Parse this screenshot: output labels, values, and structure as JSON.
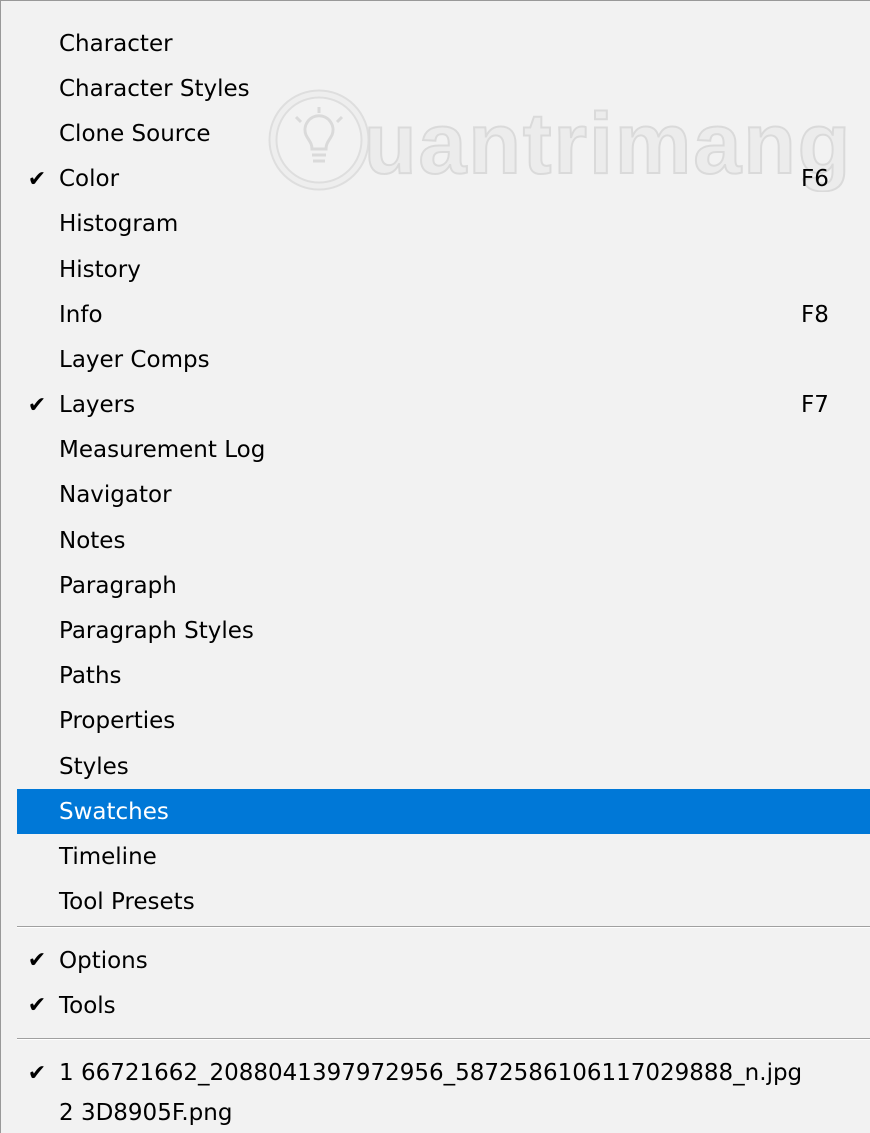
{
  "watermark": {
    "text": "uantrimang"
  },
  "panels": [
    {
      "label": "Character",
      "checked": false,
      "shortcut": ""
    },
    {
      "label": "Character Styles",
      "checked": false,
      "shortcut": ""
    },
    {
      "label": "Clone Source",
      "checked": false,
      "shortcut": ""
    },
    {
      "label": "Color",
      "checked": true,
      "shortcut": "F6"
    },
    {
      "label": "Histogram",
      "checked": false,
      "shortcut": ""
    },
    {
      "label": "History",
      "checked": false,
      "shortcut": ""
    },
    {
      "label": "Info",
      "checked": false,
      "shortcut": "F8"
    },
    {
      "label": "Layer Comps",
      "checked": false,
      "shortcut": ""
    },
    {
      "label": "Layers",
      "checked": true,
      "shortcut": "F7"
    },
    {
      "label": "Measurement Log",
      "checked": false,
      "shortcut": ""
    },
    {
      "label": "Navigator",
      "checked": false,
      "shortcut": ""
    },
    {
      "label": "Notes",
      "checked": false,
      "shortcut": ""
    },
    {
      "label": "Paragraph",
      "checked": false,
      "shortcut": ""
    },
    {
      "label": "Paragraph Styles",
      "checked": false,
      "shortcut": ""
    },
    {
      "label": "Paths",
      "checked": false,
      "shortcut": ""
    },
    {
      "label": "Properties",
      "checked": false,
      "shortcut": ""
    },
    {
      "label": "Styles",
      "checked": false,
      "shortcut": ""
    },
    {
      "label": "Swatches",
      "checked": false,
      "shortcut": "",
      "selected": true
    },
    {
      "label": "Timeline",
      "checked": false,
      "shortcut": ""
    },
    {
      "label": "Tool Presets",
      "checked": false,
      "shortcut": ""
    }
  ],
  "workspace": [
    {
      "label": "Options",
      "checked": true
    },
    {
      "label": "Tools",
      "checked": true
    }
  ],
  "documents": [
    {
      "label": "1 66721662_2088041397972956_5872586106117029888_n.jpg",
      "checked": true
    },
    {
      "label": "2 3D8905F.png",
      "checked": false
    }
  ],
  "check_glyph": "✔",
  "colors": {
    "selection": "#0078d7",
    "background": "#f2f2f2"
  }
}
